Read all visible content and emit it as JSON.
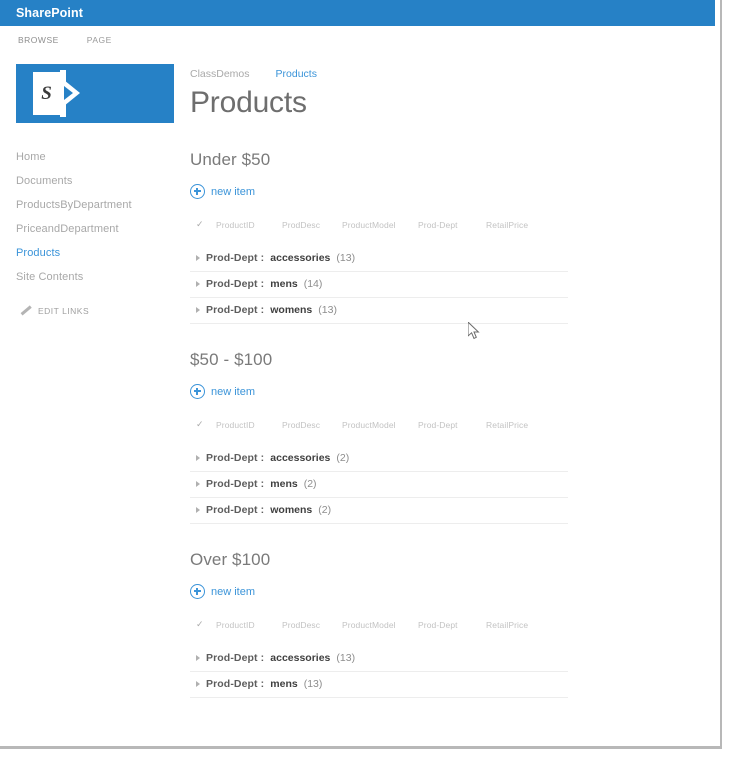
{
  "suite": {
    "brand": "SharePoint"
  },
  "ribbon": {
    "tabs": [
      {
        "label": "BROWSE"
      },
      {
        "label": "PAGE"
      }
    ]
  },
  "logo": {
    "letter": "S",
    "name": "sharepoint-logo",
    "color": "#2681c6"
  },
  "sidebar": {
    "items": [
      {
        "label": "Home",
        "selected": false
      },
      {
        "label": "Documents",
        "selected": false
      },
      {
        "label": "ProductsByDepartment",
        "selected": false
      },
      {
        "label": "PriceandDepartment",
        "selected": false
      },
      {
        "label": "Products",
        "selected": true
      },
      {
        "label": "Site Contents",
        "selected": false
      }
    ],
    "edit_links": "EDIT LINKS"
  },
  "breadcrumb": {
    "site": "ClassDemos",
    "current": "Products"
  },
  "page": {
    "title": "Products"
  },
  "list": {
    "new_item_label": "new item",
    "columns": [
      "ProductID",
      "ProdDesc",
      "ProductModel",
      "Prod-Dept",
      "RetailPrice"
    ],
    "group_field": "Prod-Dept :",
    "groups": [
      {
        "title": "Under $50",
        "new_item_label": "new item",
        "rows": [
          {
            "field": "Prod-Dept :",
            "value": "accessories",
            "count": "(13)"
          },
          {
            "field": "Prod-Dept :",
            "value": "mens",
            "count": "(14)"
          },
          {
            "field": "Prod-Dept :",
            "value": "womens",
            "count": "(13)"
          }
        ]
      },
      {
        "title": "$50 - $100",
        "new_item_label": "new item",
        "rows": [
          {
            "field": "Prod-Dept :",
            "value": "accessories",
            "count": "(2)"
          },
          {
            "field": "Prod-Dept :",
            "value": "mens",
            "count": "(2)"
          },
          {
            "field": "Prod-Dept :",
            "value": "womens",
            "count": "(2)"
          }
        ]
      },
      {
        "title": "Over $100",
        "new_item_label": "new item",
        "rows": [
          {
            "field": "Prod-Dept :",
            "value": "accessories",
            "count": "(13)"
          },
          {
            "field": "Prod-Dept :",
            "value": "mens",
            "count": "(13)"
          }
        ]
      }
    ]
  },
  "colors": {
    "suite_bar": "#2681c6",
    "link": "#3b94d9",
    "muted_text": "#a8a8a8"
  }
}
